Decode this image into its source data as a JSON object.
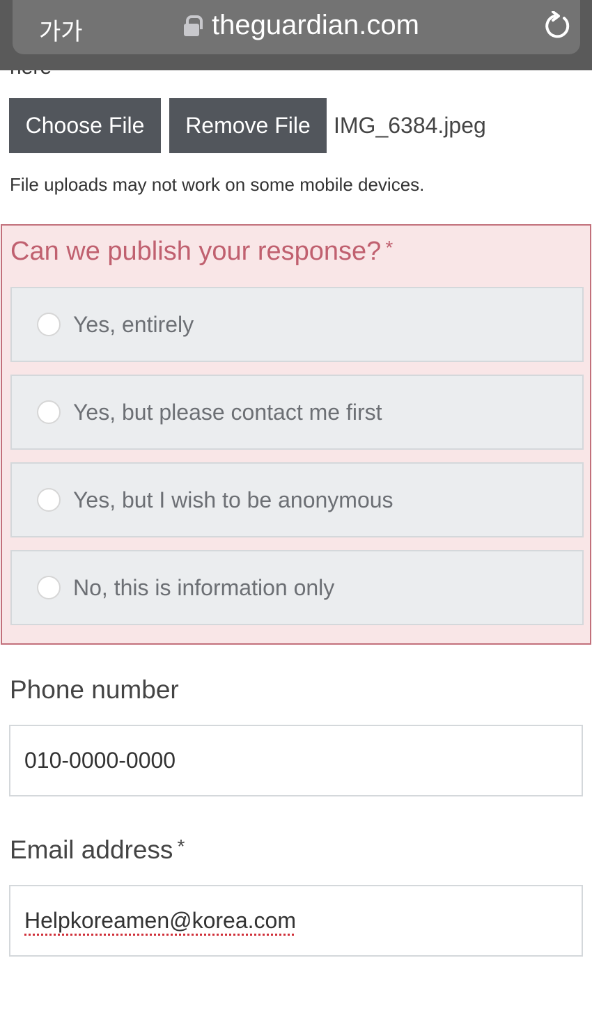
{
  "browser": {
    "text_size_label": "가가",
    "url": "theguardian.com",
    "icons": [
      "lock-icon",
      "reload-icon"
    ]
  },
  "page": {
    "clipped_text": "here",
    "upload": {
      "choose_label": "Choose File",
      "remove_label": "Remove File",
      "filename": "IMG_6384.jpeg",
      "note": "File uploads may not work on some mobile devices."
    },
    "publish": {
      "question": "Can we publish your response?",
      "required": "*",
      "options": [
        "Yes, entirely",
        "Yes, but please contact me first",
        "Yes, but I wish to be anonymous",
        "No, this is information only"
      ],
      "error_color": "#c0606f"
    },
    "phone": {
      "label": "Phone number",
      "value": "010-0000-0000"
    },
    "email": {
      "label": "Email address",
      "required": "*",
      "value": "Helpkoreamen@korea.com"
    }
  }
}
